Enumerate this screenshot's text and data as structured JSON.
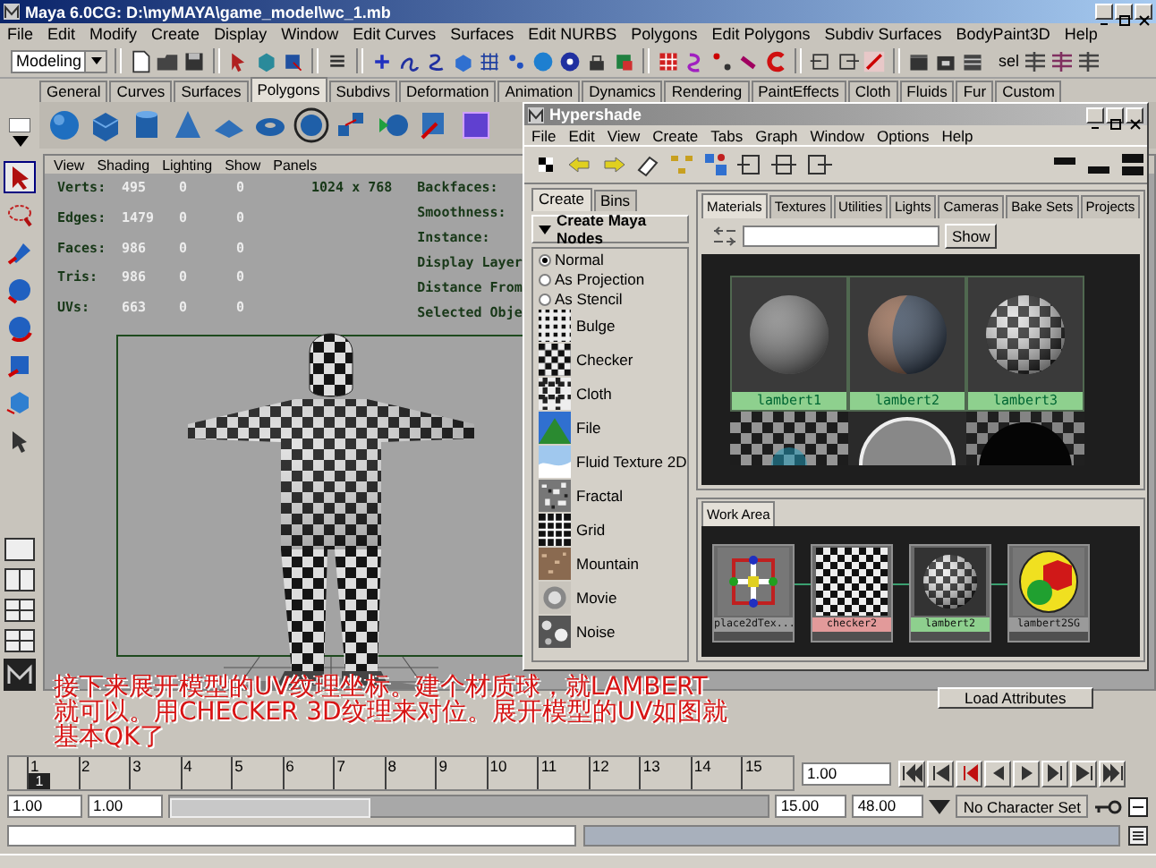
{
  "window": {
    "title": "Maya 6.0CG: D:\\myMAYA\\game_model\\wc_1.mb"
  },
  "menu_bar": [
    "File",
    "Edit",
    "Modify",
    "Create",
    "Display",
    "Window",
    "Edit Curves",
    "Surfaces",
    "Edit NURBS",
    "Polygons",
    "Edit Polygons",
    "Subdiv Surfaces",
    "BodyPaint3D",
    "Help"
  ],
  "status_line": {
    "mode": "Modeling",
    "selection_label": "sel"
  },
  "shelf": {
    "tabs": [
      {
        "label": "General",
        "selected": false
      },
      {
        "label": "Curves",
        "selected": false
      },
      {
        "label": "Surfaces",
        "selected": false
      },
      {
        "label": "Polygons",
        "selected": true
      },
      {
        "label": "Subdivs",
        "selected": false
      },
      {
        "label": "Deformation",
        "selected": false
      },
      {
        "label": "Animation",
        "selected": false
      },
      {
        "label": "Dynamics",
        "selected": false
      },
      {
        "label": "Rendering",
        "selected": false
      },
      {
        "label": "PaintEffects",
        "selected": false
      },
      {
        "label": "Cloth",
        "selected": false
      },
      {
        "label": "Fluids",
        "selected": false
      },
      {
        "label": "Fur",
        "selected": false
      },
      {
        "label": "Custom",
        "selected": false
      }
    ]
  },
  "viewport": {
    "menu": [
      "View",
      "Shading",
      "Lighting",
      "Show",
      "Panels"
    ],
    "hud_stats": [
      {
        "label": "Verts:",
        "values": [
          "495",
          "0",
          "0"
        ]
      },
      {
        "label": "Edges:",
        "values": [
          "1479",
          "0",
          "0"
        ]
      },
      {
        "label": "Faces:",
        "values": [
          "986",
          "0",
          "0"
        ]
      },
      {
        "label": "Tris:",
        "values": [
          "986",
          "0",
          "0"
        ]
      },
      {
        "label": "UVs:",
        "values": [
          "663",
          "0",
          "0"
        ]
      }
    ],
    "resolution": "1024 x 768",
    "hud_labels": [
      "Backfaces:",
      "Smoothness:",
      "Instance:",
      "Display Layer",
      "Distance From",
      "Selected Obje"
    ]
  },
  "hypershade": {
    "title": "Hypershade",
    "menu": [
      "File",
      "Edit",
      "View",
      "Create",
      "Tabs",
      "Graph",
      "Window",
      "Options",
      "Help"
    ],
    "create_tabs": [
      {
        "label": "Create",
        "selected": true
      },
      {
        "label": "Bins",
        "selected": false
      }
    ],
    "create_header": "Create Maya Nodes",
    "projection_options": [
      {
        "label": "Normal",
        "selected": true
      },
      {
        "label": "As Projection",
        "selected": false
      },
      {
        "label": "As Stencil",
        "selected": false
      }
    ],
    "texture_nodes": [
      {
        "label": "Bulge",
        "kind": "bulge"
      },
      {
        "label": "Checker",
        "kind": "checker"
      },
      {
        "label": "Cloth",
        "kind": "cloth"
      },
      {
        "label": "File",
        "kind": "file"
      },
      {
        "label": "Fluid Texture 2D",
        "kind": "fluid"
      },
      {
        "label": "Fractal",
        "kind": "fractal"
      },
      {
        "label": "Grid",
        "kind": "grid"
      },
      {
        "label": "Mountain",
        "kind": "mountain"
      },
      {
        "label": "Movie",
        "kind": "movie"
      },
      {
        "label": "Noise",
        "kind": "noise"
      }
    ],
    "tabs": [
      {
        "label": "Materials",
        "selected": true
      },
      {
        "label": "Textures",
        "selected": false
      },
      {
        "label": "Utilities",
        "selected": false
      },
      {
        "label": "Lights",
        "selected": false
      },
      {
        "label": "Cameras",
        "selected": false
      },
      {
        "label": "Bake Sets",
        "selected": false
      },
      {
        "label": "Projects",
        "selected": false
      }
    ],
    "show_button": "Show",
    "materials": [
      {
        "name": "lambert1",
        "kind": "plain"
      },
      {
        "name": "lambert2",
        "kind": "photo"
      },
      {
        "name": "lambert3",
        "kind": "checker"
      }
    ],
    "materials_row_2": [
      {
        "kind": "checker-tile"
      },
      {
        "kind": "chrome"
      },
      {
        "kind": "dark"
      }
    ],
    "work_area_tab": "Work Area",
    "graph_nodes": [
      {
        "name": "place2dTex...",
        "kind": "place2d",
        "color": "#9a9a9a"
      },
      {
        "name": "checker2",
        "kind": "checker",
        "color": "#e29a9a"
      },
      {
        "name": "lambert2",
        "kind": "checker-sphere",
        "color": "#8ed08e"
      },
      {
        "name": "lambert2SG",
        "kind": "shading-group",
        "color": "#9a9a9a"
      }
    ]
  },
  "attribute_editor": {
    "button": "Load Attributes"
  },
  "time_slider": {
    "ticks": [
      {
        "label": "1",
        "selected": true
      },
      {
        "label": "2",
        "selected": false
      },
      {
        "label": "3",
        "selected": false
      },
      {
        "label": "4",
        "selected": false
      },
      {
        "label": "5",
        "selected": false
      },
      {
        "label": "6",
        "selected": false
      },
      {
        "label": "7",
        "selected": false
      },
      {
        "label": "8",
        "selected": false
      },
      {
        "label": "9",
        "selected": false
      },
      {
        "label": "10",
        "selected": false
      },
      {
        "label": "11",
        "selected": false
      },
      {
        "label": "12",
        "selected": false
      },
      {
        "label": "13",
        "selected": false
      },
      {
        "label": "14",
        "selected": false
      },
      {
        "label": "15",
        "selected": false
      }
    ],
    "current_frame": "1",
    "current_time": "1.00"
  },
  "range_slider": {
    "level": 0.33,
    "start_time": "1.00",
    "playback_start": "1.00",
    "playback_end": "15.00",
    "end_time": "48.00",
    "character_set": "No Character Set"
  },
  "caption": {
    "lines": [
      "接下来展开模型的UV纹理坐标。建个材质球，就LAMBERT",
      "就可以。用CHECKER 3D纹理来对位。展开模型的UV如图就",
      "基本QK了"
    ]
  }
}
